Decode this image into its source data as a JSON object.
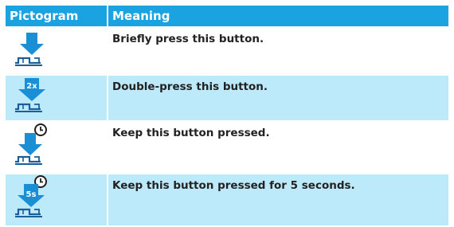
{
  "table": {
    "headers": {
      "pictogram": "Pictogram",
      "meaning": "Meaning"
    },
    "rows": [
      {
        "icon": "press-button-icon",
        "meaning": "Briefly press this button.",
        "badge": ""
      },
      {
        "icon": "double-press-button-icon",
        "meaning": "Double-press this button.",
        "badge": "2x"
      },
      {
        "icon": "hold-button-icon",
        "meaning": "Keep this button pressed.",
        "badge": ""
      },
      {
        "icon": "hold-5s-button-icon",
        "meaning": "Keep this button pressed for 5 seconds.",
        "badge": "5s"
      }
    ]
  },
  "colors": {
    "header_bg": "#1aa3e0",
    "row_alt_bg": "#bdeafb",
    "arrow_blue": "#1a8fd6"
  }
}
